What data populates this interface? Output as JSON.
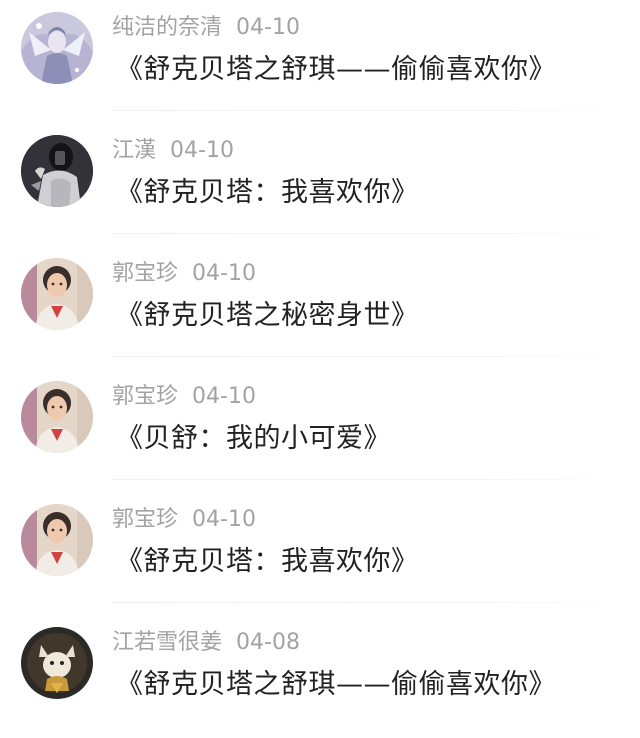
{
  "comments": [
    {
      "author": "纯洁的奈清",
      "date": "04-10",
      "text": "《舒克贝塔之舒琪——偷偷喜欢你》",
      "avatar_icon": "anime-winged-figure-avatar"
    },
    {
      "author": "江漢",
      "date": "04-10",
      "text": "《舒克贝塔：我喜欢你》",
      "avatar_icon": "dark-selfie-avatar"
    },
    {
      "author": "郭宝珍",
      "date": "04-10",
      "text": "《舒克贝塔之秘密身世》",
      "avatar_icon": "woman-portrait-avatar"
    },
    {
      "author": "郭宝珍",
      "date": "04-10",
      "text": "《贝舒：我的小可爱》",
      "avatar_icon": "woman-portrait-avatar"
    },
    {
      "author": "郭宝珍",
      "date": "04-10",
      "text": "《舒克贝塔：我喜欢你》",
      "avatar_icon": "woman-portrait-avatar"
    },
    {
      "author": "江若雪很姜",
      "date": "04-08",
      "text": "《舒克贝塔之舒琪——偷偷喜欢你》",
      "avatar_icon": "cartoon-creature-avatar"
    }
  ],
  "colors": {
    "meta_text": "#a3a3a3",
    "body_text": "#222222",
    "divider": "#f0f0f0"
  }
}
